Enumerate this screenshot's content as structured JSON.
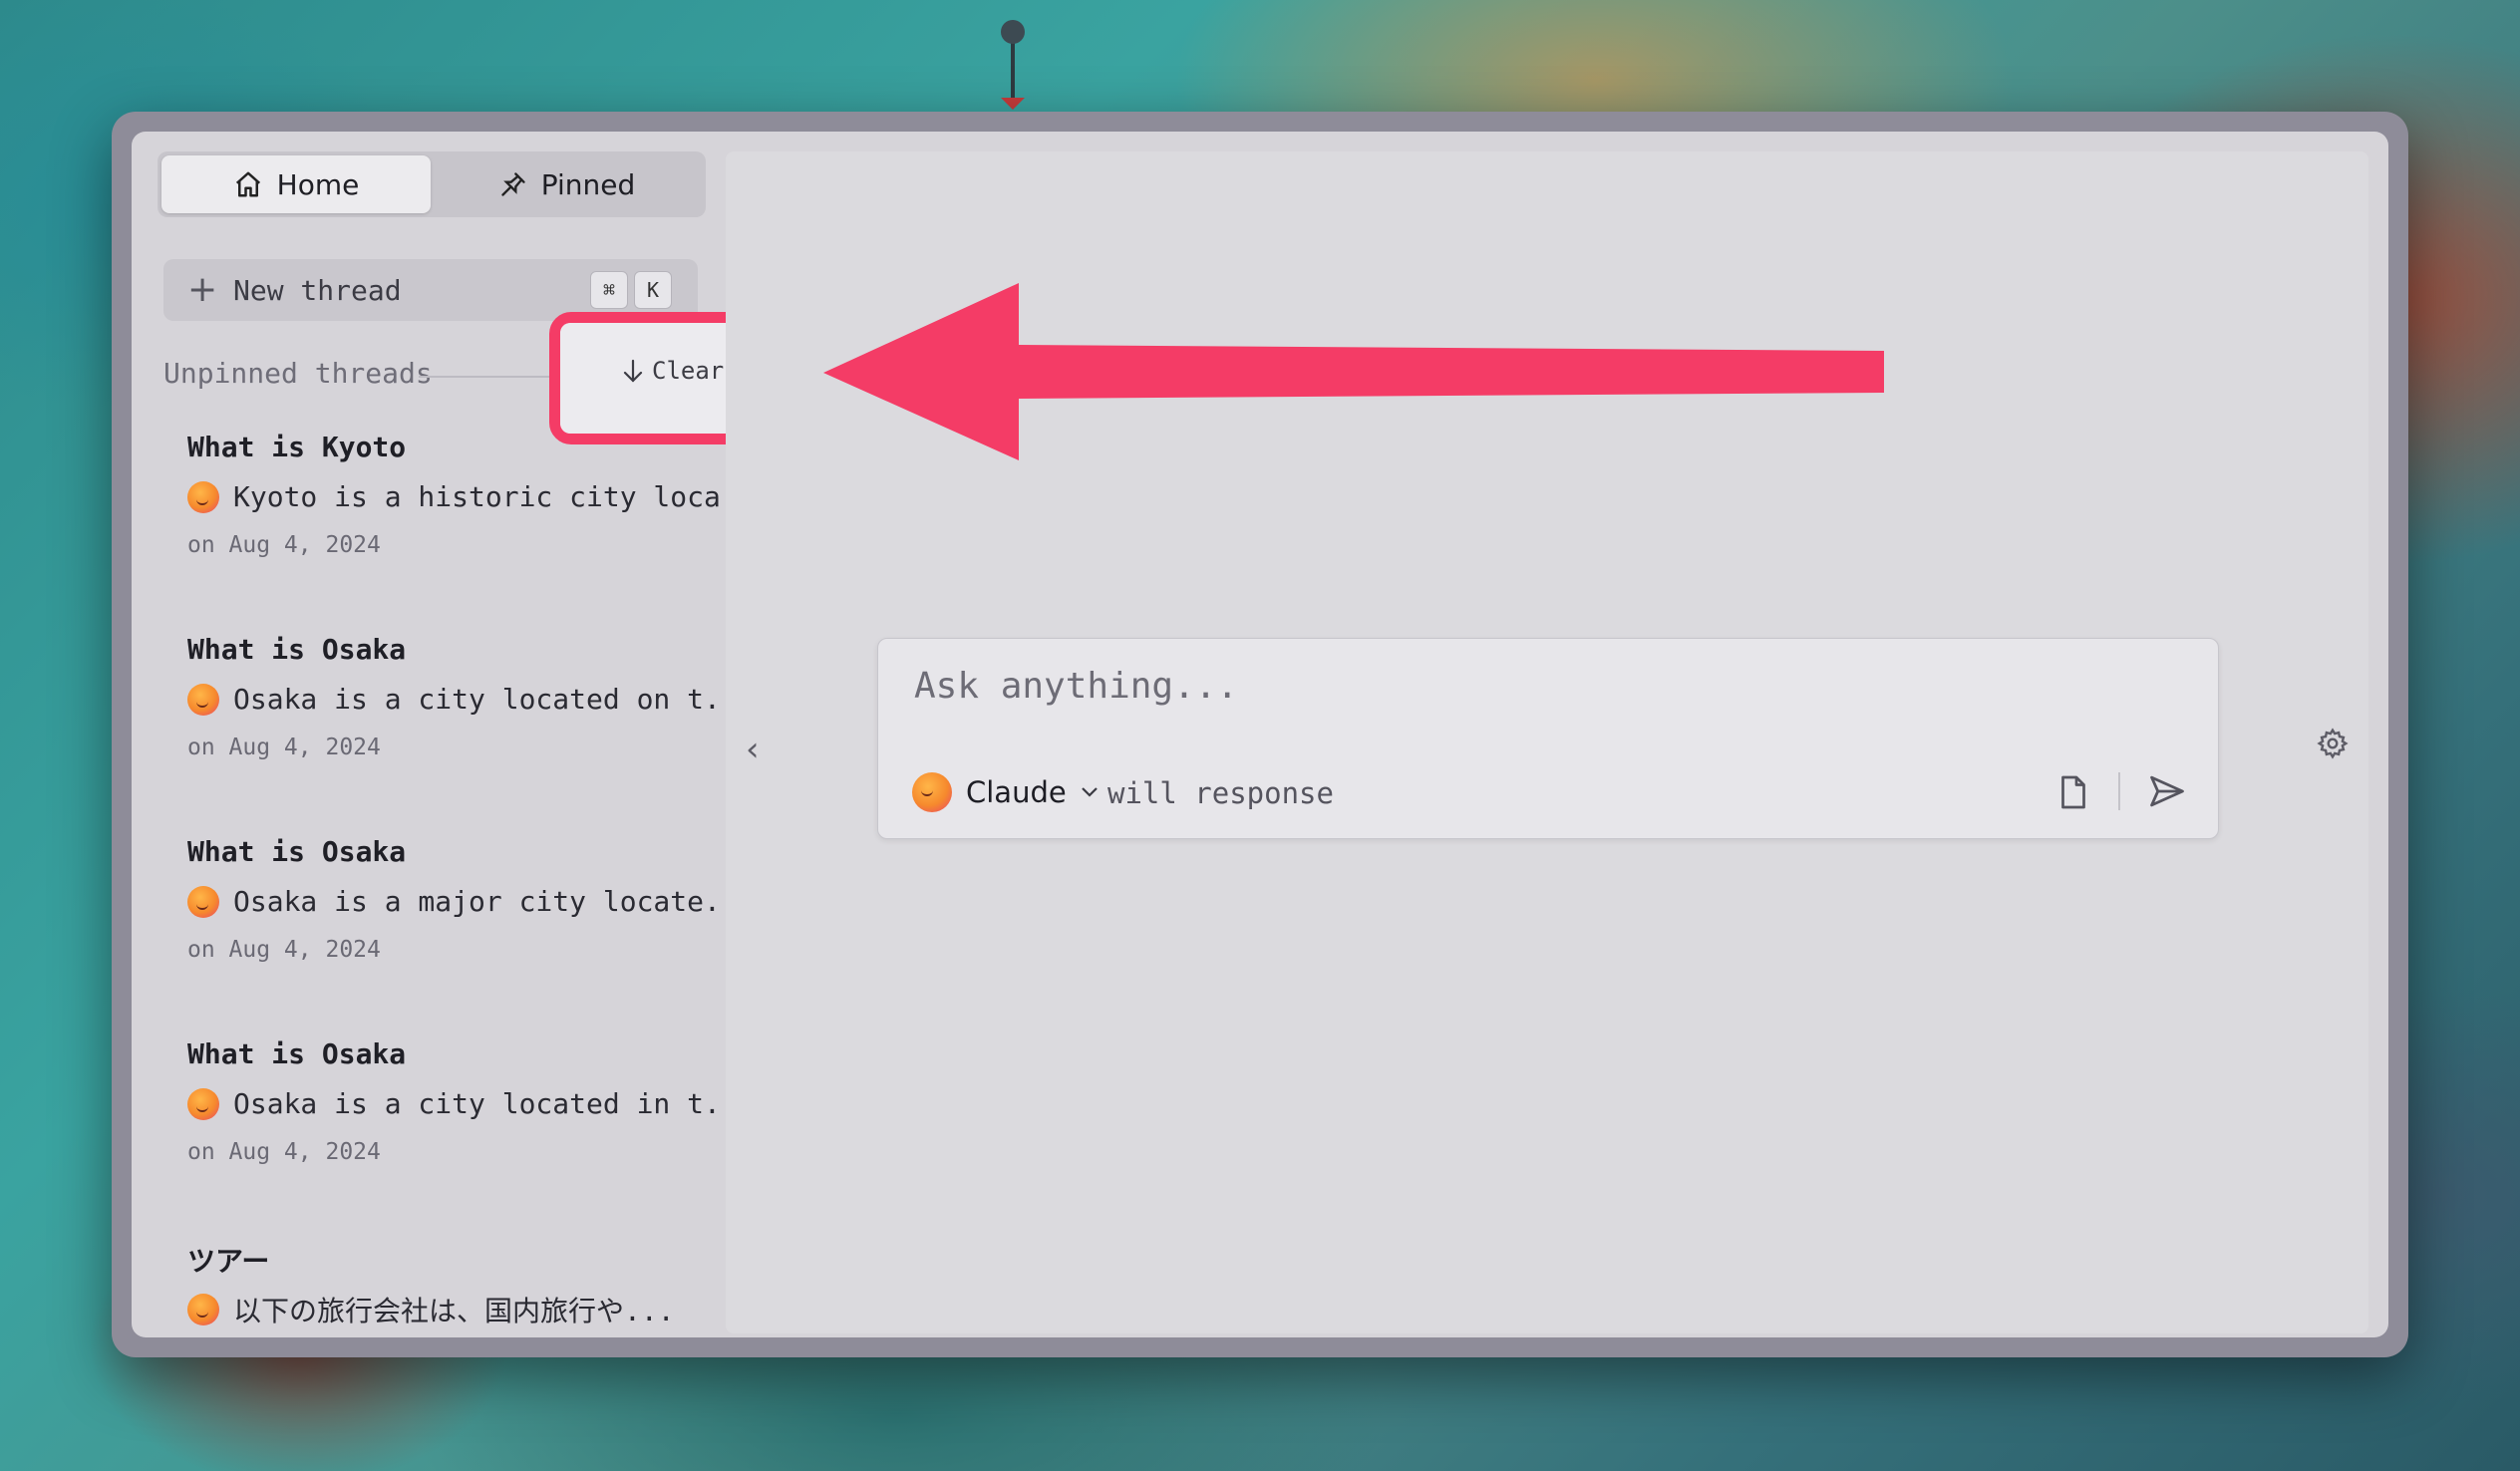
{
  "sidebar": {
    "tabs": [
      {
        "label": "Home",
        "icon": "home-icon",
        "active": true
      },
      {
        "label": "Pinned",
        "icon": "pin-icon",
        "active": false
      }
    ],
    "new_thread": {
      "label": "New thread",
      "shortcut_keys": [
        "⌘",
        "K"
      ]
    },
    "section_title": "Unpinned threads",
    "clear_label": "Clear",
    "threads": [
      {
        "title": "What is Kyoto",
        "preview": "Kyoto is a historic city loca...",
        "date": "on Aug 4, 2024"
      },
      {
        "title": "What is Osaka",
        "preview": "Osaka is a city located on t...",
        "date": "on Aug 4, 2024"
      },
      {
        "title": "What is Osaka",
        "preview": "Osaka is a major city locate...",
        "date": "on Aug 4, 2024"
      },
      {
        "title": "What is Osaka",
        "preview": "Osaka is a city located in t...",
        "date": "on Aug 4, 2024"
      },
      {
        "title": "ツアー",
        "preview": "以下の旅行会社は、国内旅行や...",
        "date": ""
      }
    ]
  },
  "composer": {
    "placeholder": "Ask anything...",
    "model": "Claude",
    "model_suffix": "will response"
  },
  "icons": {
    "collapse": "chevron-left-icon",
    "settings": "gear-icon",
    "attach": "file-icon",
    "send": "send-icon"
  },
  "colors": {
    "highlight": "#f43c66"
  }
}
